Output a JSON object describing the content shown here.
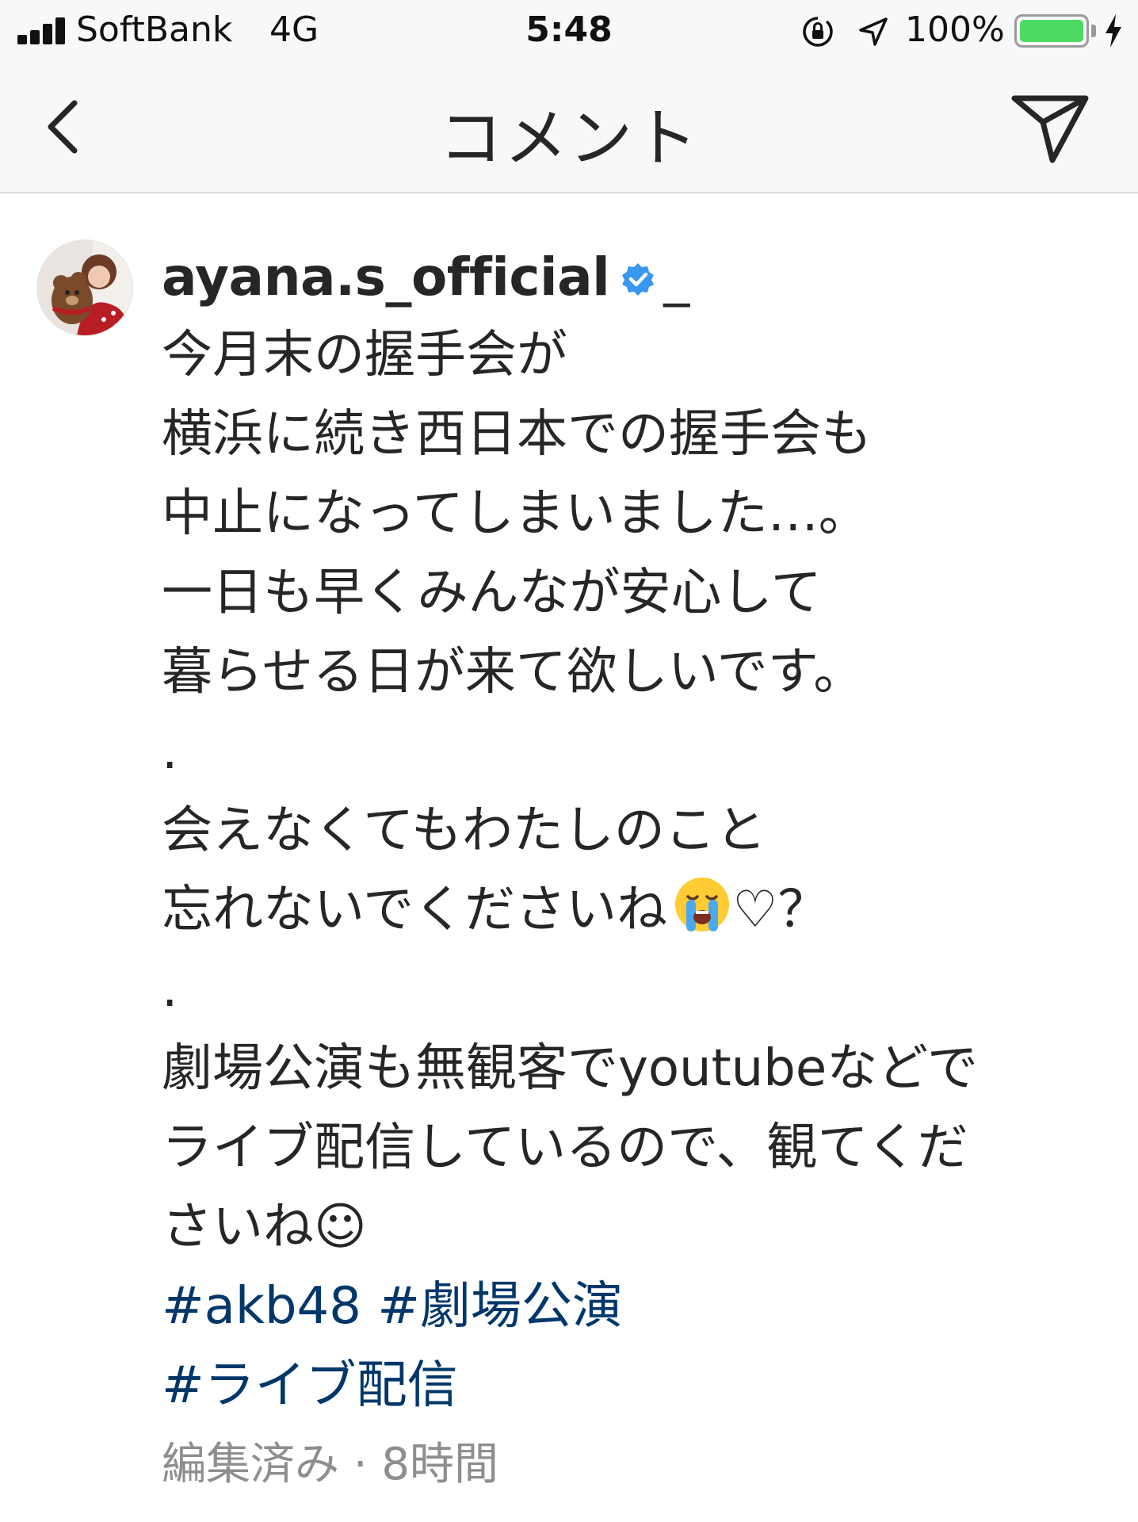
{
  "status_bar": {
    "carrier": "SoftBank",
    "network": "4G",
    "time": "5:48",
    "battery_percent": "100%",
    "battery_level": 1.0,
    "battery_color": "#4cd964"
  },
  "nav": {
    "title": "コメント",
    "back_icon": "chevron-left-icon",
    "share_icon": "paper-plane-icon"
  },
  "caption": {
    "username": "ayana.s_official",
    "verified_icon": "verified-badge-icon",
    "suffix": "_",
    "lines": [
      "今月末の握手会が",
      "横浜に続き西日本での握手会も",
      "中止になってしまいました…。",
      "一日も早くみんなが安心して",
      "暮らせる日が来て欲しいです。",
      "."
    ],
    "line7": "会えなくてもわたしのこと",
    "line8_before_emoji": "忘れないでくださいね",
    "line8_after_emoji": "♡？",
    "emoji": "crying-face-emoji",
    "dot2": ".",
    "lines_b": [
      "劇場公演も無観客でyoutubeなどで",
      "ライブ配信しているので、観てくだ",
      "さいね☺︎"
    ],
    "hashtags": {
      "tag1": "#akb48",
      "tag2": "#劇場公演",
      "tag3": "#ライブ配信"
    },
    "meta": "編集済み · 8時間",
    "hashtag_color": "#00376b"
  }
}
